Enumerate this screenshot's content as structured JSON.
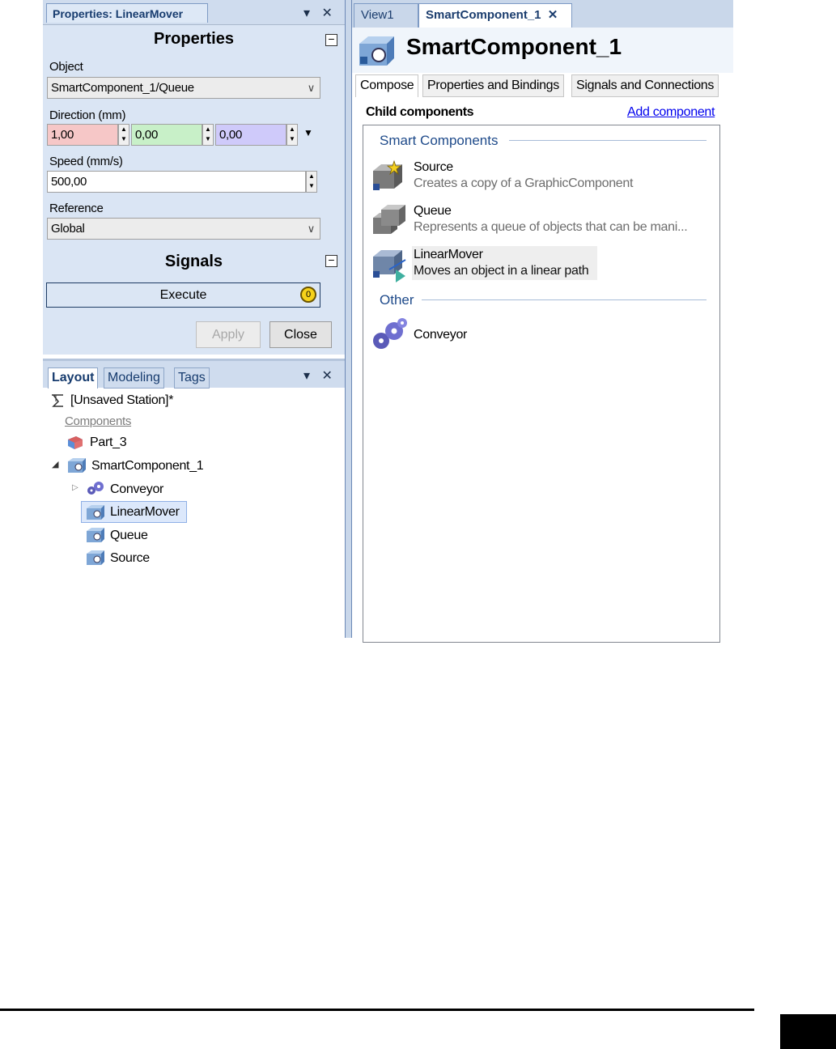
{
  "properties_panel": {
    "tab_title": "Properties: LinearMover",
    "pin_glyph": "▾",
    "close_glyph": "✕",
    "properties_header": "Properties",
    "collapse_glyph": "−",
    "object_label": "Object",
    "object_value": "SmartComponent_1/Queue",
    "direction_label": "Direction (mm)",
    "direction_x": "1,00",
    "direction_y": "0,00",
    "direction_z": "0,00",
    "speed_label": "Speed (mm/s)",
    "speed_value": "500,00",
    "reference_label": "Reference",
    "reference_value": "Global",
    "signals_header": "Signals",
    "execute_label": "Execute",
    "execute_badge": "0",
    "apply_label": "Apply",
    "close_label": "Close",
    "colors": {
      "x": "#f6c7c7",
      "y": "#c8f0c8",
      "z": "#cfcafa"
    }
  },
  "layout_panel": {
    "tabs": [
      {
        "label": "Layout",
        "active": true
      },
      {
        "label": "Modeling",
        "active": false
      },
      {
        "label": "Tags",
        "active": false
      }
    ],
    "tree": {
      "station": "[Unsaved Station]*",
      "components_header": "Components",
      "part": "Part_3",
      "smart_component": "SmartComponent_1",
      "children": [
        "Conveyor",
        "LinearMover",
        "Queue",
        "Source"
      ],
      "selected": "LinearMover"
    }
  },
  "document": {
    "tabs": [
      {
        "label": "View1",
        "active": false
      },
      {
        "label": "SmartComponent_1",
        "active": true
      }
    ],
    "tab_close_glyph": "✕",
    "title": "SmartComponent_1",
    "content_tabs": [
      {
        "label": "Compose",
        "active": true
      },
      {
        "label": "Properties and Bindings",
        "active": false
      },
      {
        "label": "Signals and Connections",
        "active": false
      }
    ],
    "child_components_label": "Child components",
    "add_component_link": "Add component",
    "groups": [
      {
        "name": "Smart Components",
        "items": [
          {
            "name": "Source",
            "description": "Creates a copy of a GraphicComponent",
            "icon": "source-icon"
          },
          {
            "name": "Queue",
            "description": "Represents a queue of objects that can be mani...",
            "icon": "queue-icon"
          },
          {
            "name": "LinearMover",
            "description": "Moves an object in a linear path",
            "icon": "linear-mover-icon"
          }
        ]
      },
      {
        "name": "Other",
        "items": [
          {
            "name": "Conveyor",
            "description": "",
            "icon": "gears-icon"
          }
        ]
      }
    ]
  }
}
